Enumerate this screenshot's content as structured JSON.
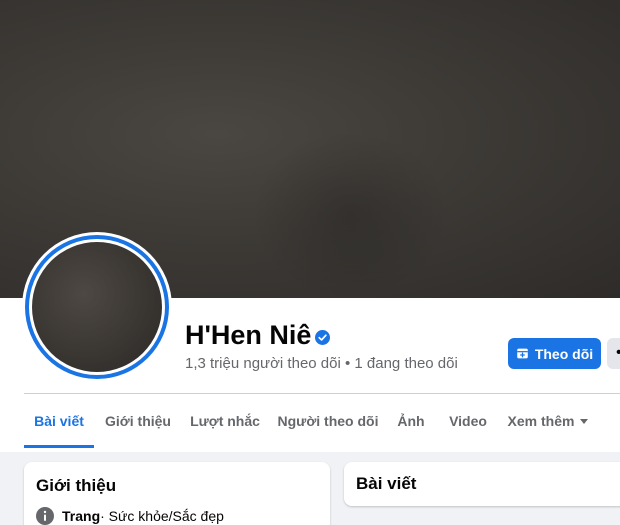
{
  "profile": {
    "name": "H'Hen Niê",
    "stats": "1,3 triệu người theo dõi • 1 đang theo dõi",
    "follow_label": "Theo dõi",
    "verified_icon": "verified-badge-icon",
    "accent_color": "#1b74e4"
  },
  "tabs": [
    {
      "label": "Bài viết",
      "active": true
    },
    {
      "label": "Giới thiệu",
      "active": false
    },
    {
      "label": "Lượt nhắc",
      "active": false
    },
    {
      "label": "Người theo dõi",
      "active": false
    },
    {
      "label": "Ảnh",
      "active": false
    },
    {
      "label": "Video",
      "active": false
    },
    {
      "label": "Xem thêm",
      "active": false
    }
  ],
  "intro": {
    "title": "Giới thiệu",
    "page_type": "Trang",
    "category": " · Sức khỏe/Sắc đẹp"
  },
  "posts": {
    "title": "Bài viết"
  }
}
